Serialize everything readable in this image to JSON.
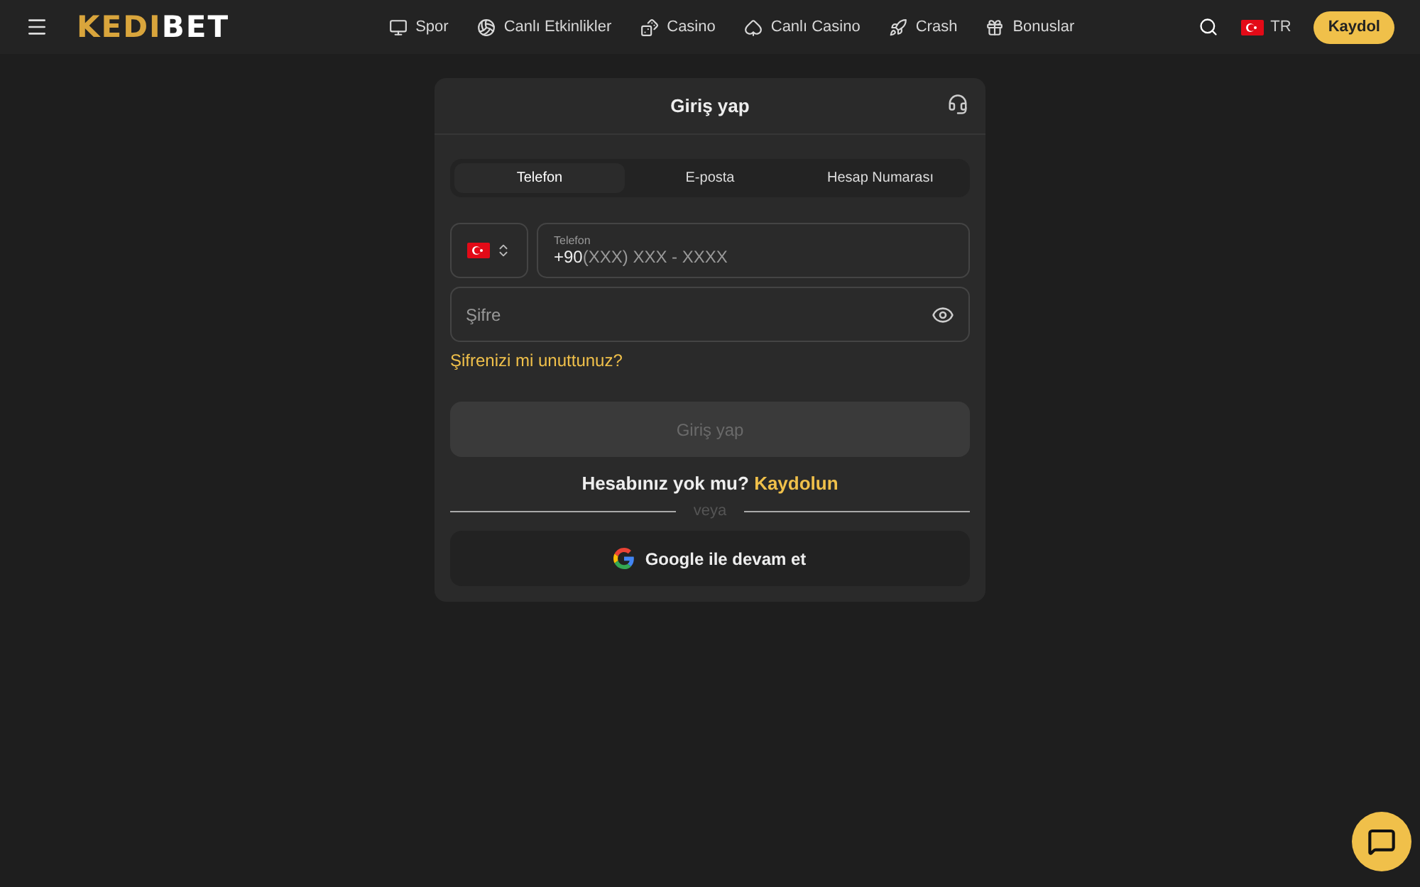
{
  "header": {
    "logo": {
      "accent": "KEDI",
      "plain": "BET"
    },
    "nav": [
      {
        "label": "Spor"
      },
      {
        "label": "Canlı Etkinlikler"
      },
      {
        "label": "Casino"
      },
      {
        "label": "Canlı Casino"
      },
      {
        "label": "Crash"
      },
      {
        "label": "Bonuslar"
      }
    ],
    "language": "TR",
    "register_button": "Kaydol"
  },
  "login": {
    "title": "Giriş yap",
    "tabs": [
      {
        "label": "Telefon",
        "selected": true
      },
      {
        "label": "E-posta",
        "selected": false
      },
      {
        "label": "Hesap Numarası",
        "selected": false
      }
    ],
    "phone": {
      "label": "Telefon",
      "prefix": "+90",
      "placeholder": "(XXX) XXX - XXXX"
    },
    "password": {
      "placeholder": "Şifre"
    },
    "forgot_link": "Şifrenizi mi unuttunuz?",
    "submit": {
      "label": "Giriş yap",
      "disabled": true
    },
    "signup_prompt": "Hesabınız yok mu?",
    "signup_link": "Kaydolun",
    "divider": "veya",
    "google_button": "Google ile devam et"
  }
}
